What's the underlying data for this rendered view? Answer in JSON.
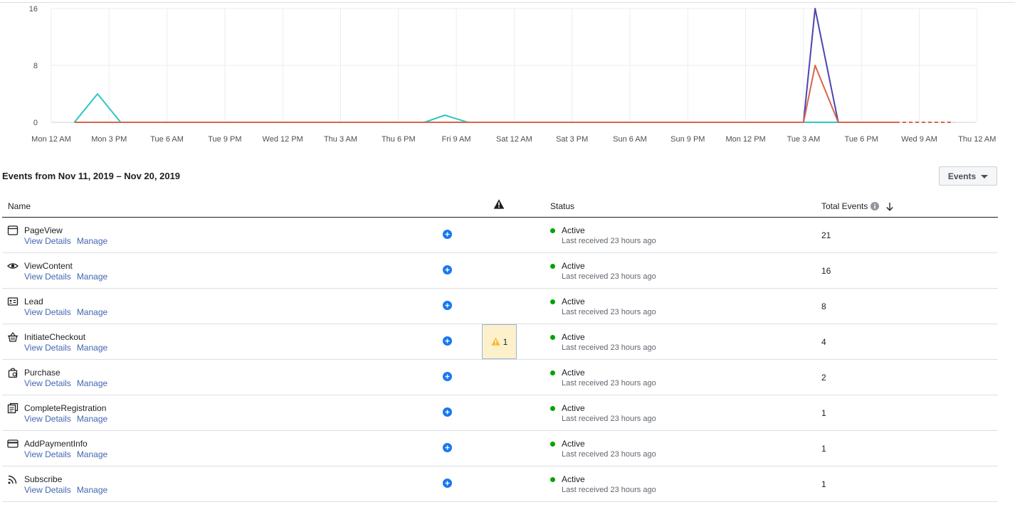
{
  "chart_data": {
    "type": "line",
    "x": [
      "Mon 12 AM",
      "Mon 3 PM",
      "Tue 6 AM",
      "Tue 9 PM",
      "Wed 12 PM",
      "Thu 3 AM",
      "Thu 6 PM",
      "Fri 9 AM",
      "Sat 12 AM",
      "Sat 3 PM",
      "Sun 6 AM",
      "Sun 9 PM",
      "Mon 12 PM",
      "Tue 3 AM",
      "Tue 6 PM",
      "Wed 9 AM",
      "Thu 12 AM"
    ],
    "y_ticks": [
      "16",
      "8",
      "0"
    ],
    "ylim": [
      0,
      16
    ],
    "grid": true,
    "series": [
      {
        "color": "#2ec7c0",
        "points": [
          [
            0.4,
            0
          ],
          [
            0.8,
            4
          ],
          [
            1.2,
            0
          ],
          [
            6.45,
            0
          ],
          [
            6.8,
            1
          ],
          [
            7.2,
            0
          ],
          [
            13.0,
            0
          ],
          [
            14.6,
            0
          ]
        ]
      },
      {
        "color": "#4b45b0",
        "points": [
          [
            0.4,
            0
          ],
          [
            13.0,
            0
          ],
          [
            13.2,
            16
          ],
          [
            13.6,
            0
          ],
          [
            14.6,
            0
          ]
        ]
      },
      {
        "color": "#d9654b",
        "points": [
          [
            0.4,
            0
          ],
          [
            13.0,
            0
          ],
          [
            13.2,
            8
          ],
          [
            13.6,
            0
          ],
          [
            14.6,
            0
          ]
        ],
        "dashed_from": 14.6,
        "dashed_to": 15.6
      }
    ]
  },
  "range_title": "Events from Nov 11, 2019 – Nov 20, 2019",
  "events_button": "Events",
  "columns": {
    "name": "Name",
    "status": "Status",
    "total": "Total Events"
  },
  "icons": {
    "warning": "warning-icon",
    "info": "info-icon",
    "sort": "sort-down-icon",
    "add": "plus-circle-icon"
  },
  "rows": [
    {
      "name": "PageView",
      "icon": "browser-window-icon",
      "view": "View Details",
      "manage": "Manage",
      "status": "Active",
      "received": "Last received 23 hours ago",
      "total": "21"
    },
    {
      "name": "ViewContent",
      "icon": "eye-icon",
      "view": "View Details",
      "manage": "Manage",
      "status": "Active",
      "received": "Last received 23 hours ago",
      "total": "16"
    },
    {
      "name": "Lead",
      "icon": "id-card-icon",
      "view": "View Details",
      "manage": "Manage",
      "status": "Active",
      "received": "Last received 23 hours ago",
      "total": "8"
    },
    {
      "name": "InitiateCheckout",
      "icon": "basket-icon",
      "view": "View Details",
      "manage": "Manage",
      "status": "Active",
      "received": "Last received 23 hours ago",
      "total": "4",
      "warnings": "1"
    },
    {
      "name": "Purchase",
      "icon": "shopping-bag-icon",
      "view": "View Details",
      "manage": "Manage",
      "status": "Active",
      "received": "Last received 23 hours ago",
      "total": "2"
    },
    {
      "name": "CompleteRegistration",
      "icon": "registration-form-icon",
      "view": "View Details",
      "manage": "Manage",
      "status": "Active",
      "received": "Last received 23 hours ago",
      "total": "1"
    },
    {
      "name": "AddPaymentInfo",
      "icon": "credit-card-icon",
      "view": "View Details",
      "manage": "Manage",
      "status": "Active",
      "received": "Last received 23 hours ago",
      "total": "1"
    },
    {
      "name": "Subscribe",
      "icon": "rss-feed-icon",
      "view": "View Details",
      "manage": "Manage",
      "status": "Active",
      "received": "Last received 23 hours ago",
      "total": "1"
    }
  ]
}
